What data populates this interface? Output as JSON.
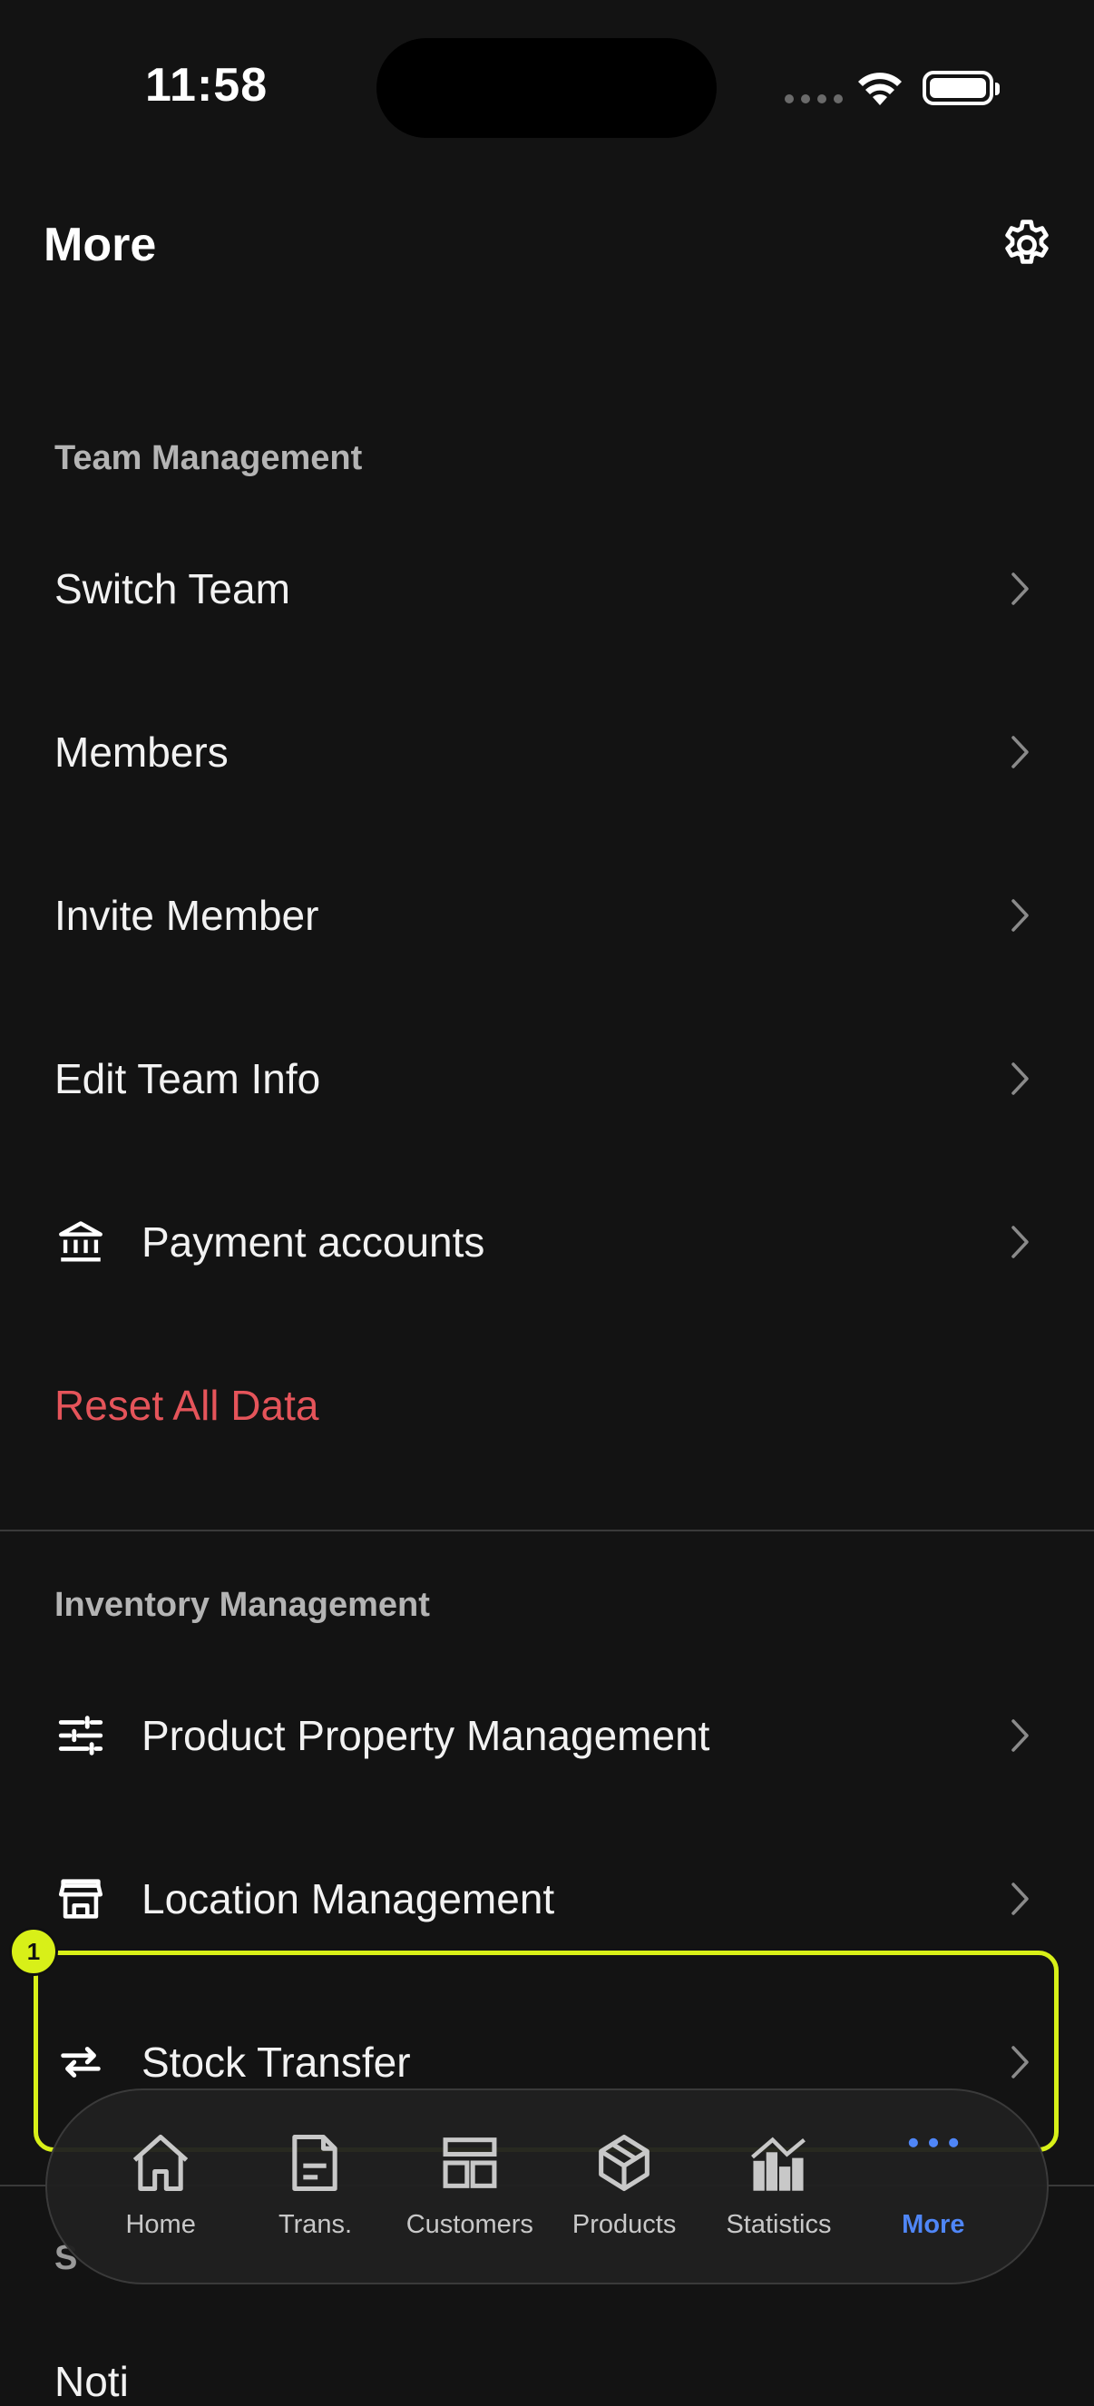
{
  "status_bar": {
    "time": "11:58"
  },
  "header": {
    "title": "More",
    "settings_icon": "gear-icon"
  },
  "sections": {
    "team": {
      "title": "Team Management",
      "items": [
        {
          "label": "Switch Team"
        },
        {
          "label": "Members"
        },
        {
          "label": "Invite Member"
        },
        {
          "label": "Edit Team Info"
        },
        {
          "label": "Payment accounts",
          "icon": "bank-icon"
        },
        {
          "label": "Reset All Data",
          "color": "#e5545a"
        }
      ]
    },
    "inventory": {
      "title": "Inventory Management",
      "items": [
        {
          "label": "Product Property Management",
          "icon": "sliders-icon"
        },
        {
          "label": "Location Management",
          "icon": "store-icon"
        },
        {
          "label": "Stock Transfer",
          "icon": "transfer-arrows-icon"
        }
      ]
    },
    "next": {
      "title_partial": "S",
      "item_partial": "Noti"
    }
  },
  "highlight_badge": "1",
  "tab_bar": {
    "tabs": [
      {
        "label": "Home",
        "icon": "home-icon"
      },
      {
        "label": "Trans.",
        "icon": "document-icon"
      },
      {
        "label": "Customers",
        "icon": "grid-icon"
      },
      {
        "label": "Products",
        "icon": "box-icon"
      },
      {
        "label": "Statistics",
        "icon": "bar-chart-icon"
      },
      {
        "label": "More",
        "icon": "more-dots-icon",
        "active": true
      }
    ],
    "accent": "#4f86f7"
  }
}
